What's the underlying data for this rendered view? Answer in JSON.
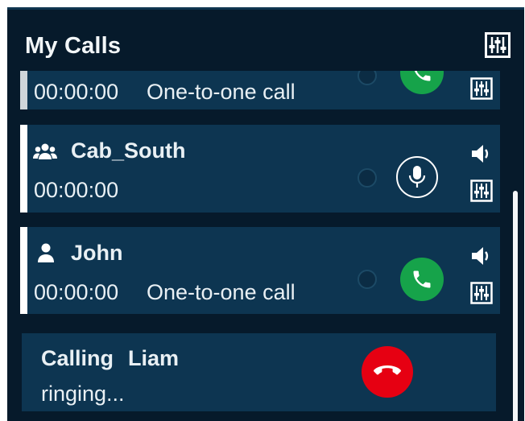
{
  "panel": {
    "title": "My Calls"
  },
  "calls": [
    {
      "time": "00:00:00",
      "type": "One-to-one call"
    },
    {
      "name": "Cab_South",
      "time": "00:00:00",
      "icon": "group-icon"
    },
    {
      "name": "John",
      "time": "00:00:00",
      "type": "One-to-one call",
      "icon": "person-icon"
    }
  ],
  "outgoing": {
    "label": "Calling",
    "name": "Liam",
    "status": "ringing..."
  },
  "colors": {
    "background": "#061a2b",
    "card": "#0d3551",
    "answer": "#16a34a",
    "hangup": "#e60012"
  }
}
